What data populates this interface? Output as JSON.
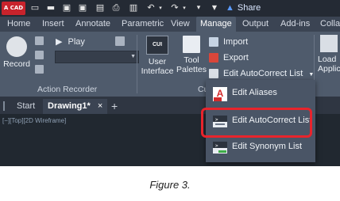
{
  "app": {
    "logo_text": "A CAD"
  },
  "quick_access": {
    "icons": [
      "new-icon",
      "open-icon",
      "save-icon",
      "save-as-icon",
      "print-icon",
      "undo-icon",
      "redo-icon",
      "share-icon"
    ],
    "share_label": "Share"
  },
  "tabs": [
    "Home",
    "Insert",
    "Annotate",
    "Parametric",
    "View",
    "Manage",
    "Output",
    "Add-ins",
    "Colla"
  ],
  "active_tab": "Manage",
  "ribbon": {
    "record_label": "Record",
    "play_label": "Play",
    "panel_action_recorder": "Action Recorder",
    "cui_badge": "CUI",
    "user_interface_label_1": "User",
    "user_interface_label_2": "Interface",
    "tool_palettes_label_1": "Tool",
    "tool_palettes_label_2": "Palettes",
    "panel_customization_partial": "Cu",
    "import_label": "Import",
    "export_label": "Export",
    "edit_autocorrect_list_label": "Edit AutoCorrect List",
    "load_application_label_1": "Load",
    "load_application_label_2": "Applicati"
  },
  "doc_tabs": {
    "start": "Start",
    "drawing": "Drawing1*",
    "close": "×",
    "new": "+"
  },
  "viewport_label": "[−][Top][2D Wireframe]",
  "dropdown": {
    "items": [
      {
        "label": "Edit Aliases",
        "icon": "pgp-aliases-icon"
      },
      {
        "label": "Edit AutoCorrect List",
        "icon": "autocorrect-list-icon",
        "highlighted": true
      },
      {
        "label": "Edit Synonym List",
        "icon": "synonym-list-icon"
      }
    ],
    "highlight_color": "#e8242c"
  },
  "caption": "Figure 3."
}
